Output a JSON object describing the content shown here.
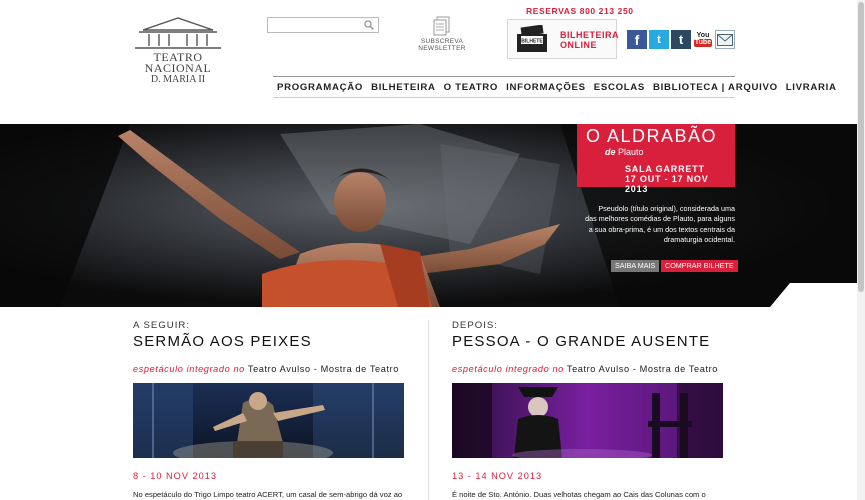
{
  "header": {
    "logo": {
      "line1": "TEATRO",
      "line2": "NACIONAL",
      "line3": "D. MARIA II"
    },
    "search": {
      "value": "",
      "placeholder": ""
    },
    "newsletter": {
      "line1": "SUBSCREVA",
      "line2": "NEWSLETTER"
    },
    "reservas": "RESERVAS 800 213 250",
    "ticket": {
      "label_line1": "BILHETEIRA",
      "label_line2": "ONLINE",
      "icon_text": "BILHETE"
    },
    "social": [
      {
        "name": "facebook",
        "glyph": "f"
      },
      {
        "name": "twitter",
        "glyph": "t"
      },
      {
        "name": "tumblr",
        "glyph": "t"
      },
      {
        "name": "youtube",
        "glyph_top": "You",
        "glyph_bottom": "Tube"
      },
      {
        "name": "email",
        "glyph": ""
      }
    ]
  },
  "nav": {
    "items": [
      "PROGRAMAÇÃO",
      "BILHETEIRA",
      "O TEATRO",
      "INFORMAÇÕES",
      "ESCOLAS",
      "BIBLIOTECA | ARQUIVO",
      "LIVRARIA"
    ]
  },
  "hero": {
    "title": "O ALDRABÃO",
    "by_prefix": "de",
    "author": "Plauto",
    "hall": "SALA GARRETT",
    "dates": "17 OUT - 17 NOV 2013",
    "description": "Pseudolo (título original), considerada uma das melhores comédias de Plauto, para alguns a sua obra-prima, é um dos textos centrais da dramaturgia ocidental.",
    "more_label": "SAIBA MAIS",
    "buy_label": "COMPRAR BILHETE",
    "colors": {
      "accent": "#d81f3c"
    }
  },
  "next": {
    "kicker": "A SEGUIR:",
    "title": "SERMÃO AOS PEIXES",
    "integrated_prefix": "espetáculo integrado no",
    "integrated_name": "Teatro Avulso - Mostra de Teatro",
    "dates": "8 - 10 NOV 2013",
    "description": "No espetáculo do Trigo Limpo teatro ACERT, um casal de sem-abrigo dá voz ao"
  },
  "after": {
    "kicker": "DEPOIS:",
    "title": "PESSOA - O GRANDE AUSENTE",
    "integrated_prefix": "espetáculo integrado no",
    "integrated_name": "Teatro Avulso - Mostra de Teatro",
    "dates": "13 - 14 NOV 2013",
    "description": "É noite de Sto. António. Duas velhotas chegam ao Cais das Colunas com o"
  }
}
